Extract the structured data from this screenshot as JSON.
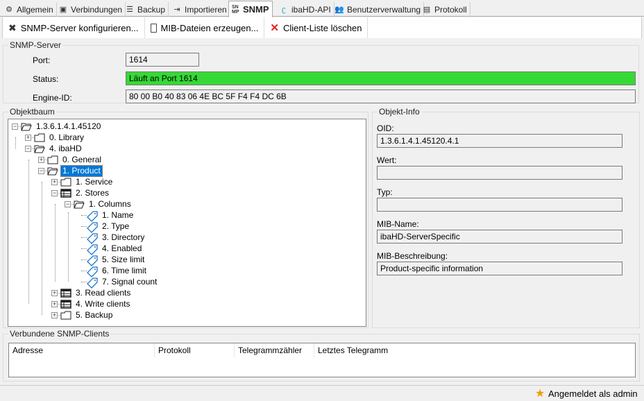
{
  "tabs": [
    {
      "label": "Allgemein",
      "icon": "gear-icon"
    },
    {
      "label": "Verbindungen",
      "icon": "hd-connection-icon"
    },
    {
      "label": "Backup",
      "icon": "database-icon"
    },
    {
      "label": "Importieren",
      "icon": "import-icon"
    },
    {
      "label": "SNMP",
      "icon": "snmp-icon",
      "icon_text": "SN MP",
      "active": true
    },
    {
      "label": "ibaHD-API",
      "icon": "api-icon"
    },
    {
      "label": "Benutzerverwaltung",
      "icon": "users-icon"
    },
    {
      "label": "Protokoll",
      "icon": "log-icon"
    }
  ],
  "toolbar": {
    "configure": "SNMP-Server konfigurieren...",
    "mib": "MIB-Dateien erzeugen...",
    "clear": "Client-Liste löschen"
  },
  "server": {
    "title": "SNMP-Server",
    "port_label": "Port:",
    "port": "1614",
    "status_label": "Status:",
    "status": "Läuft an Port 1614",
    "status_color": "#35d935",
    "engine_label": "Engine-ID:",
    "engine": "80 00 B0 40 83 06 4E BC 5F F4 F4 DC 6B"
  },
  "tree": {
    "title": "Objektbaum",
    "nodes": [
      {
        "label": "1.3.6.1.4.1.45120",
        "level": 0,
        "exp": "-",
        "icon": "folder-open"
      },
      {
        "label": "0. Library",
        "level": 1,
        "exp": "+",
        "icon": "folder"
      },
      {
        "label": "4. ibaHD",
        "level": 1,
        "exp": "-",
        "icon": "folder-open"
      },
      {
        "label": "0. General",
        "level": 2,
        "exp": "+",
        "icon": "folder"
      },
      {
        "label": "1. Product",
        "level": 2,
        "exp": "-",
        "icon": "folder-open",
        "selected": true
      },
      {
        "label": "1. Service",
        "level": 3,
        "exp": "+",
        "icon": "folder"
      },
      {
        "label": "2. Stores",
        "level": 3,
        "exp": "-",
        "icon": "table"
      },
      {
        "label": "1. Columns",
        "level": 4,
        "exp": "-",
        "icon": "folder-open"
      },
      {
        "label": "1. Name",
        "level": 5,
        "icon": "tag"
      },
      {
        "label": "2. Type",
        "level": 5,
        "icon": "tag"
      },
      {
        "label": "3. Directory",
        "level": 5,
        "icon": "tag"
      },
      {
        "label": "4. Enabled",
        "level": 5,
        "icon": "tag"
      },
      {
        "label": "5. Size limit",
        "level": 5,
        "icon": "tag"
      },
      {
        "label": "6. Time limit",
        "level": 5,
        "icon": "tag"
      },
      {
        "label": "7. Signal count",
        "level": 5,
        "icon": "tag"
      },
      {
        "label": "3. Read clients",
        "level": 3,
        "exp": "+",
        "icon": "table"
      },
      {
        "label": "4. Write clients",
        "level": 3,
        "exp": "+",
        "icon": "table"
      },
      {
        "label": "5. Backup",
        "level": 3,
        "exp": "+",
        "icon": "folder"
      }
    ]
  },
  "info": {
    "title": "Objekt-Info",
    "oid_label": "OID:",
    "oid": "1.3.6.1.4.1.45120.4.1",
    "wert_label": "Wert:",
    "wert": "",
    "typ_label": "Typ:",
    "typ": "",
    "mibname_label": "MIB-Name:",
    "mibname": "ibaHD-ServerSpecific",
    "mibdesc_label": "MIB-Beschreibung:",
    "mibdesc": "Product-specific information"
  },
  "clients": {
    "title": "Verbundene SNMP-Clients",
    "columns": [
      "Adresse",
      "Protokoll",
      "Telegrammzähler",
      "Letztes Telegramm"
    ]
  },
  "status": {
    "text": "Angemeldet als admin"
  }
}
